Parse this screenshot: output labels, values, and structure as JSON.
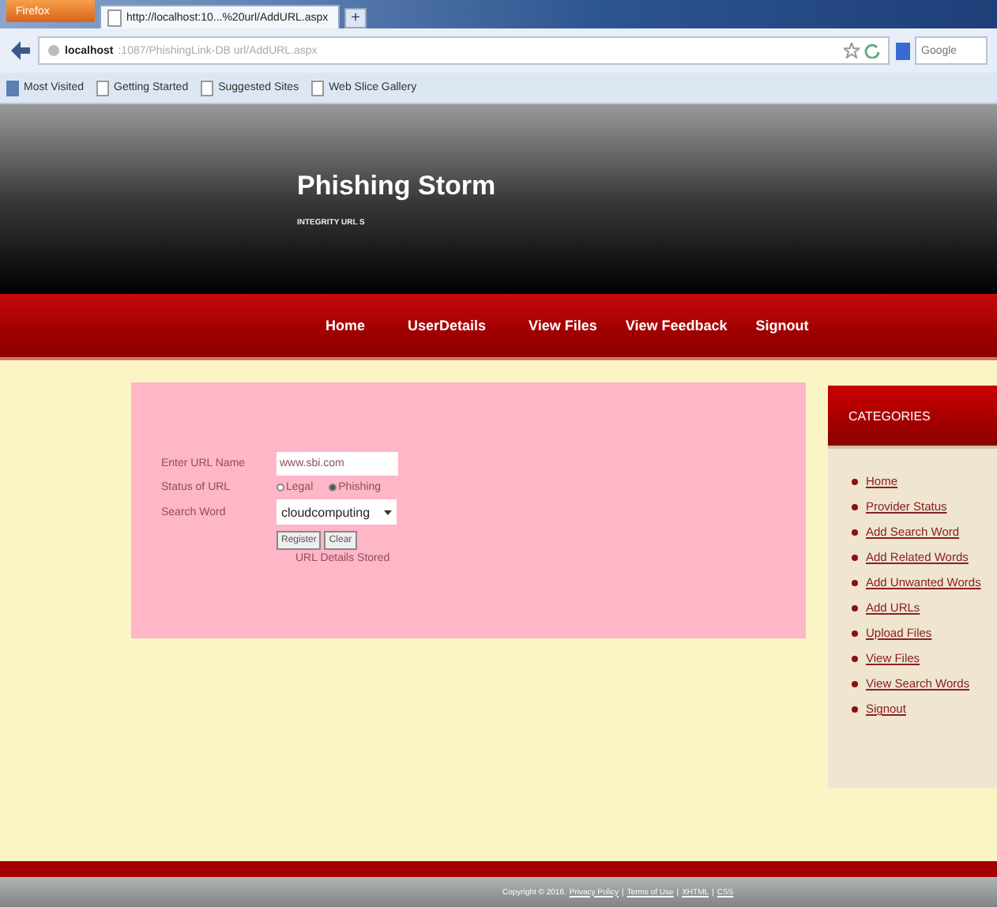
{
  "browser": {
    "menu_button": "Firefox",
    "tab": {
      "title": "http://localhost:10...%20url/AddURL.aspx",
      "selected": true
    },
    "new_tab": "+",
    "address": {
      "host": "localhost",
      "path": ":1087/PhishingLink-DB url/AddURL.aspx"
    },
    "search_placeholder": "Google",
    "bookmarks": [
      "Most Visited",
      "Getting Started",
      "Suggested Sites",
      "Web Slice Gallery"
    ]
  },
  "site": {
    "title": "Phishing Storm",
    "subtitle": "INTEGRITY URL S"
  },
  "nav": [
    "Home",
    "UserDetails",
    "View Files",
    "View Feedback",
    "Signout"
  ],
  "form": {
    "fields": [
      {
        "kind": "text",
        "label": "Enter URL Name",
        "value": "www.sbi.com"
      },
      {
        "kind": "radio",
        "label": "Status of URL",
        "options": [
          {
            "label": "Legal",
            "selected": false
          },
          {
            "label": "Phishing",
            "selected": true
          }
        ]
      },
      {
        "kind": "select",
        "label": "Search Word",
        "value": "cloudcomputing"
      }
    ],
    "buttons": [
      "Register",
      "Clear"
    ],
    "message": "URL Details Stored"
  },
  "sidebar": {
    "title": "CATEGORIES",
    "items": [
      "Home",
      "Provider Status",
      "Add Search Word",
      "Add Related Words",
      "Add Unwanted Words",
      "Add URLs",
      "Upload Files",
      "View Files",
      "View Search Words",
      "Signout"
    ]
  },
  "footer": {
    "text": "Copyright © 2016.",
    "separator": "|",
    "links": [
      "Privacy Policy",
      "Terms of Use",
      "XHTML",
      "CSS"
    ]
  }
}
